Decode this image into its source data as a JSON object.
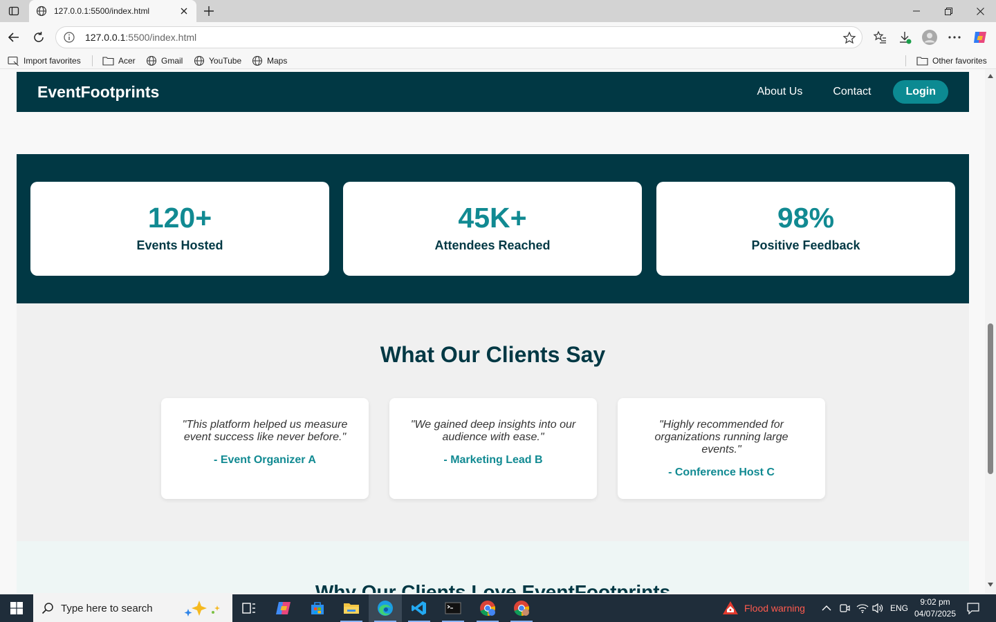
{
  "browser": {
    "tab_title": "127.0.0.1:5500/index.html",
    "url_host": "127.0.0.1",
    "url_rest": ":5500/index.html",
    "favorites": [
      "Import favorites",
      "Acer",
      "Gmail",
      "YouTube",
      "Maps"
    ],
    "other_favorites": "Other favorites"
  },
  "site": {
    "brand": "EventFootprints",
    "nav": {
      "about": "About Us",
      "contact": "Contact",
      "login": "Login"
    },
    "stats": [
      {
        "value": "120+",
        "label": "Events Hosted"
      },
      {
        "value": "45K+",
        "label": "Attendees Reached"
      },
      {
        "value": "98%",
        "label": "Positive Feedback"
      }
    ],
    "testimonials": {
      "title": "What Our Clients Say",
      "items": [
        {
          "quote": "\"This platform helped us measure event success like never before.\"",
          "author": "- Event Organizer A"
        },
        {
          "quote": "\"We gained deep insights into our audience with ease.\"",
          "author": "- Marketing Lead B"
        },
        {
          "quote": "\"Highly recommended for organizations running large events.\"",
          "author": "- Conference Host C"
        }
      ]
    },
    "why_title": "Why Our Clients Love EventFootprints"
  },
  "taskbar": {
    "search_placeholder": "Type here to search",
    "weather": "Flood warning",
    "lang": "ENG",
    "time": "9:02 pm",
    "date": "04/07/2025"
  },
  "colors": {
    "primary_dark": "#013844",
    "accent_teal": "#118a92",
    "login_button": "#0c8a92"
  }
}
